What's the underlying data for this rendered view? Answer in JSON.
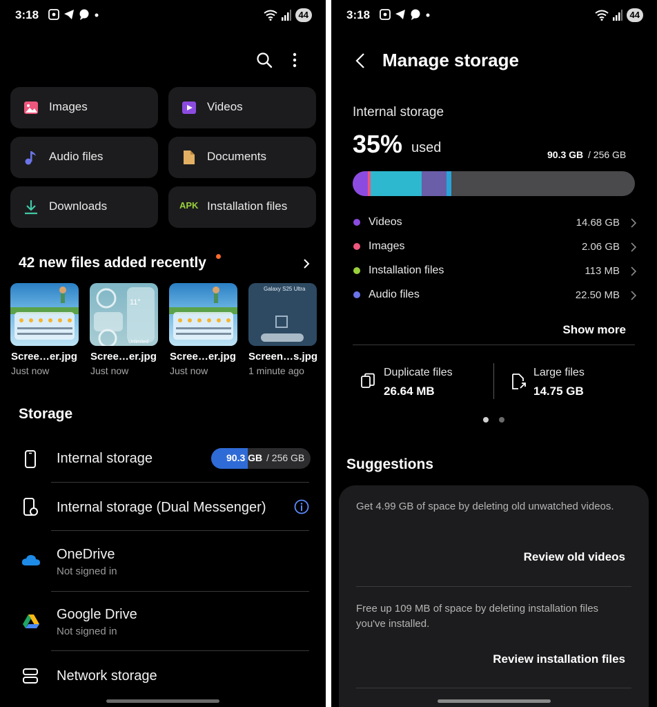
{
  "left": {
    "status": {
      "time": "3:18",
      "battery": "44"
    },
    "categories": [
      {
        "label": "Images",
        "icon": "image-icon",
        "color": "#f0577d"
      },
      {
        "label": "Videos",
        "icon": "video-icon",
        "color": "#8c4be0"
      },
      {
        "label": "Audio files",
        "icon": "music-note-icon",
        "color": "#6b74e8"
      },
      {
        "label": "Documents",
        "icon": "document-icon",
        "color": "#e3b063"
      },
      {
        "label": "Downloads",
        "icon": "download-icon",
        "color": "#42c9a6"
      },
      {
        "label": "Installation files",
        "icon": "apk-icon",
        "color": "#9ad03b",
        "icon_text": "APK"
      }
    ],
    "recent": {
      "title": "42 new files added recently",
      "files": [
        {
          "name": "Scree…er.jpg",
          "time": "Just now"
        },
        {
          "name": "Scree…er.jpg",
          "time": "Just now"
        },
        {
          "name": "Scree…er.jpg",
          "time": "Just now"
        },
        {
          "name": "Screen…s.jpg",
          "time": "1 minute ago"
        }
      ],
      "thumb_texts": {
        "temp": "11°",
        "unlimited": "Unlimited",
        "phone_title": "Galaxy S25 Ultra"
      }
    },
    "storage": {
      "title": "Storage",
      "internal": {
        "title": "Internal storage",
        "used": "90.3 GB",
        "total": "/ 256 GB",
        "fraction": 0.35
      },
      "dual": {
        "title": "Internal storage (Dual Messenger)"
      },
      "onedrive": {
        "title": "OneDrive",
        "subtitle": "Not signed in"
      },
      "gdrive": {
        "title": "Google Drive",
        "subtitle": "Not signed in"
      },
      "network": {
        "title": "Network storage"
      }
    }
  },
  "right": {
    "status": {
      "time": "3:18",
      "battery": "44"
    },
    "header": {
      "title": "Manage storage"
    },
    "internal": {
      "title": "Internal storage",
      "percent": "35%",
      "used_word": "used",
      "used": "90.3 GB",
      "total": "/ 256 GB",
      "fraction": 0.35
    },
    "breakdown": [
      {
        "label": "Videos",
        "size": "14.68 GB",
        "color": "#8c4be0"
      },
      {
        "label": "Images",
        "size": "2.06 GB",
        "color": "#f0577d"
      },
      {
        "label": "Installation files",
        "size": "113 MB",
        "color": "#9ad03b"
      },
      {
        "label": "Audio files",
        "size": "22.50 MB",
        "color": "#6b74e8"
      }
    ],
    "show_more": "Show more",
    "duplicate": {
      "label": "Duplicate files",
      "size": "26.64 MB"
    },
    "large": {
      "label": "Large files",
      "size": "14.75 GB"
    },
    "suggestions": {
      "title": "Suggestions",
      "items": [
        {
          "text": "Get 4.99 GB of space by deleting old unwatched videos.",
          "button": "Review old videos"
        },
        {
          "text": "Free up 109 MB of space by deleting installation files you've installed.",
          "button": "Review installation files"
        }
      ]
    }
  }
}
